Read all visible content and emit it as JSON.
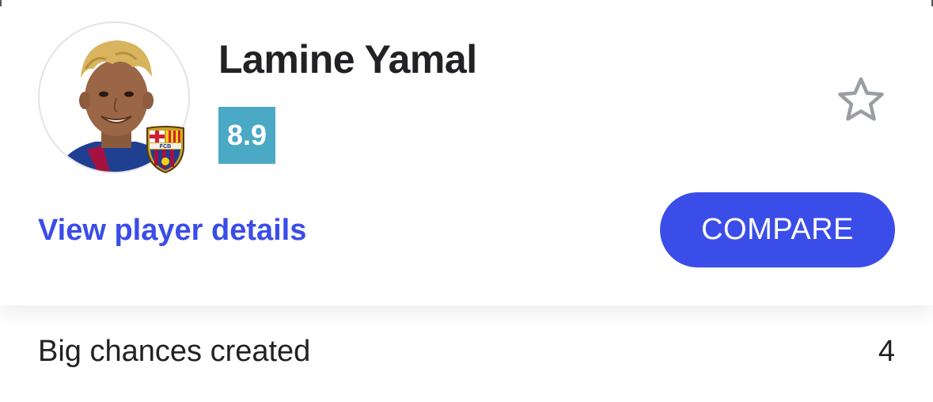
{
  "player": {
    "name": "Lamine Yamal",
    "rating": "8.9",
    "club_badge_text": "FCB"
  },
  "actions": {
    "details_link": "View player details",
    "compare_label": "COMPARE"
  },
  "stats": [
    {
      "label": "Big chances created",
      "value": "4"
    }
  ],
  "icons": {
    "favorite": "star-outline-icon",
    "club": "fc-barcelona-crest"
  },
  "colors": {
    "accent": "#3b4de8",
    "rating_bg": "#4aa9c4",
    "text": "#222226",
    "icon_gray": "#9a9da3"
  }
}
